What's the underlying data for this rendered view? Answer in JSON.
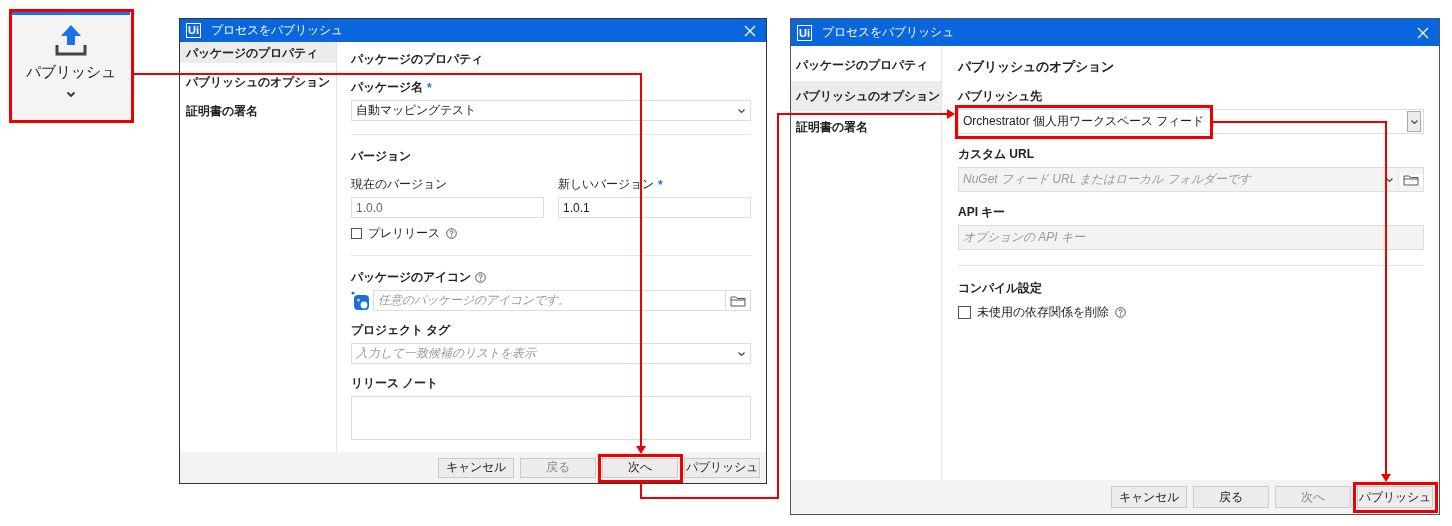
{
  "ribbon_button": {
    "label": "パブリッシュ"
  },
  "dialogs": [
    {
      "logo_text": "Ui",
      "title": "プロセスをパブリッシュ",
      "sidebar": [
        {
          "label": "パッケージのプロパティ",
          "selected": true
        },
        {
          "label": "パブリッシュのオプション",
          "selected": false
        },
        {
          "label": "証明書の署名",
          "selected": false
        }
      ],
      "heading": "パッケージのプロパティ",
      "items": [
        {
          "kind": "dropdown",
          "label": "パッケージ名",
          "required_mark": "*",
          "value": "自動マッピングテスト",
          "disabled": false
        },
        {
          "kind": "divider"
        },
        {
          "kind": "section",
          "label": "バージョン"
        },
        {
          "kind": "text_pair",
          "fields": [
            {
              "label": "現在のバージョン",
              "value": "1.0.0",
              "disabled": true
            },
            {
              "label": "新しいバージョン",
              "required_mark": "*",
              "value": "1.0.1",
              "disabled": false
            }
          ]
        },
        {
          "kind": "checkbox",
          "label": "プレリリース",
          "checked": false,
          "help": true
        },
        {
          "kind": "divider"
        },
        {
          "kind": "icon_picker",
          "label": "パッケージのアイコン",
          "help": true,
          "placeholder": "任意のパッケージのアイコンです。",
          "disabled": false
        },
        {
          "kind": "dropdown",
          "label": "プロジェクト タグ",
          "placeholder": "入力して一致候補のリストを表示",
          "disabled": false
        },
        {
          "kind": "textarea",
          "label": "リリース ノート",
          "disabled": false
        }
      ],
      "buttons": [
        {
          "label": "キャンセル",
          "disabled": false
        },
        {
          "label": "戻る",
          "disabled": true
        },
        {
          "label": "次へ",
          "disabled": false
        },
        {
          "label": "パブリッシュ",
          "disabled": false
        }
      ]
    },
    {
      "logo_text": "Ui",
      "title": "プロセスをパブリッシュ",
      "sidebar": [
        {
          "label": "パッケージのプロパティ",
          "selected": false
        },
        {
          "label": "パブリッシュのオプション",
          "selected": true
        },
        {
          "label": "証明書の署名",
          "selected": false
        }
      ],
      "heading": "パブリッシュのオプション",
      "items": [
        {
          "kind": "dropdown",
          "label": "パブリッシュ先",
          "value": "Orchestrator 個人用ワークスペース フィード",
          "disabled": false
        },
        {
          "kind": "dropdown",
          "label": "カスタム URL",
          "placeholder": "NuGet フィード URL またはローカル フォルダーです",
          "disabled": true,
          "browse": true
        },
        {
          "kind": "text",
          "label": "API キー",
          "placeholder": "オプションの API キー",
          "disabled": true
        },
        {
          "kind": "divider"
        },
        {
          "kind": "section",
          "label": "コンパイル設定"
        },
        {
          "kind": "checkbox",
          "label": "未使用の依存関係を削除",
          "checked": false,
          "help": true
        }
      ],
      "buttons": [
        {
          "label": "キャンセル",
          "disabled": false
        },
        {
          "label": "戻る",
          "disabled": false
        },
        {
          "label": "次へ",
          "disabled": true
        },
        {
          "label": "パブリッシュ",
          "disabled": false
        }
      ]
    }
  ]
}
